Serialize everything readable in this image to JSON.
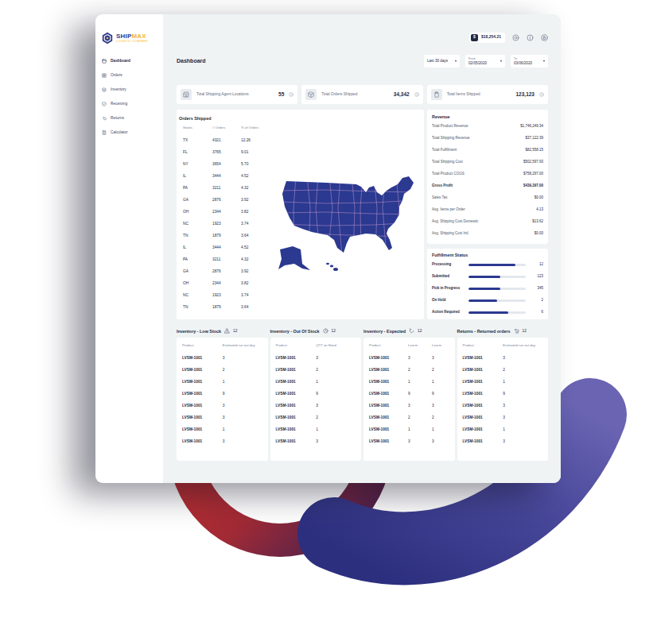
{
  "logo": {
    "name_a": "SHIP",
    "name_b": "MAX",
    "tagline": "LOGISTIC COMPANY"
  },
  "sidebar": {
    "items": [
      {
        "label": "Dashboard",
        "selected": true
      },
      {
        "label": "Orders",
        "selected": false
      },
      {
        "label": "Inventory",
        "selected": false
      },
      {
        "label": "Receiving",
        "selected": false
      },
      {
        "label": "Returns",
        "selected": false
      },
      {
        "label": "Calculator",
        "selected": false
      }
    ]
  },
  "header": {
    "currency_symbol": "$",
    "balance": "$18,254.21"
  },
  "page": {
    "title": "Dashboard",
    "range": "Last 30 days",
    "from_label": "From",
    "from": "02/05/2020",
    "to_label": "To",
    "to": "03/06/2020"
  },
  "stats": [
    {
      "label": "Total Shipping Agent Locations",
      "value": "55"
    },
    {
      "label": "Total Orders Shipped",
      "value": "34,342"
    },
    {
      "label": "Total Items Shipped",
      "value": "123,123"
    }
  ],
  "orders": {
    "title": "Orders Shipped",
    "columns": [
      "States",
      "# Orders",
      "% of Orders"
    ],
    "rows": [
      [
        "TX",
        "4321",
        "12.26"
      ],
      [
        "FL",
        "3765",
        "9.01"
      ],
      [
        "NY",
        "3654",
        "5.70"
      ],
      [
        "IL",
        "3444",
        "4.52"
      ],
      [
        "PA",
        "3211",
        "4.32"
      ],
      [
        "GA",
        "2876",
        "3.92"
      ],
      [
        "OH",
        "2344",
        "3.82"
      ],
      [
        "NC",
        "1923",
        "3.74"
      ],
      [
        "TN",
        "1879",
        "3.64"
      ],
      [
        "IL",
        "3444",
        "4.52"
      ],
      [
        "PA",
        "3211",
        "4.32"
      ],
      [
        "GA",
        "2876",
        "3.92"
      ],
      [
        "OH",
        "2344",
        "3.82"
      ],
      [
        "NC",
        "1923",
        "3.74"
      ],
      [
        "TN",
        "1879",
        "3.64"
      ]
    ]
  },
  "revenue": {
    "title": "Revenue",
    "rows": [
      {
        "label": "Total Product Revenue",
        "value": "$1,746,249.34",
        "emphasized": false
      },
      {
        "label": "Total Shipping Revenue",
        "value": "$37,122.39",
        "emphasized": false
      },
      {
        "label": "Total Fulfillment",
        "value": "$82,558.15",
        "emphasized": false
      },
      {
        "label": "Total Shipping Cost",
        "value": "$502,597.93",
        "emphasized": false
      },
      {
        "label": "Total Product COGS",
        "value": "$758,297.00",
        "emphasized": false
      },
      {
        "label": "Gross Profit",
        "value": "$439,297.00",
        "emphasized": true
      },
      {
        "label": "Sales Tax",
        "value": "$0.00",
        "emphasized": false
      },
      {
        "label": "Avg. Items per Order",
        "value": "4.13",
        "emphasized": false
      },
      {
        "label": "Avg. Shipping Cost Domestic",
        "value": "$13.62",
        "emphasized": false
      },
      {
        "label": "Avg. Shipping Cost Intl.",
        "value": "$0.00",
        "emphasized": false
      }
    ]
  },
  "fulfillment": {
    "title": "Fulfillment Status",
    "items": [
      {
        "label": "Processing",
        "count": "12",
        "level": 0.82
      },
      {
        "label": "Submitted",
        "count": "123",
        "level": 0.55
      },
      {
        "label": "Pick in Progress",
        "count": "345",
        "level": 0.55
      },
      {
        "label": "On Hold",
        "count": "2",
        "level": 0.5
      },
      {
        "label": "Action Required",
        "count": "6",
        "level": 0.7
      }
    ]
  },
  "panels": [
    {
      "title": "Inventory - Low Stock",
      "count": "12",
      "columns": [
        "Product",
        "Estimated run out day"
      ],
      "rows": [
        [
          "LVSM-1001",
          "3"
        ],
        [
          "LVSM-1001",
          "2"
        ],
        [
          "LVSM-1001",
          "1"
        ],
        [
          "LVSM-1001",
          "9"
        ],
        [
          "LVSM-1001",
          "3"
        ],
        [
          "LVSM-1001",
          "3"
        ],
        [
          "LVSM-1001",
          "1"
        ],
        [
          "LVSM-1001",
          "3"
        ]
      ]
    },
    {
      "title": "Inventory - Out Of Stock",
      "count": "12",
      "columns": [
        "Product",
        "QTY on Hand"
      ],
      "rows": [
        [
          "LVSM-1001",
          "3"
        ],
        [
          "LVSM-1001",
          "2"
        ],
        [
          "LVSM-1001",
          "1"
        ],
        [
          "LVSM-1001",
          "9"
        ],
        [
          "LVSM-1001",
          "3"
        ],
        [
          "LVSM-1001",
          "2"
        ],
        [
          "LVSM-1001",
          "1"
        ],
        [
          "LVSM-1001",
          "3"
        ]
      ]
    },
    {
      "title": "Inventory - Expected",
      "count": "12",
      "columns": [
        "Product",
        "Lorem",
        "Lorem"
      ],
      "rows": [
        [
          "LVSM-1001",
          "3",
          "3"
        ],
        [
          "LVSM-1001",
          "2",
          "2"
        ],
        [
          "LVSM-1001",
          "1",
          "1"
        ],
        [
          "LVSM-1001",
          "9",
          "9"
        ],
        [
          "LVSM-1001",
          "3",
          "3"
        ],
        [
          "LVSM-1001",
          "2",
          "2"
        ],
        [
          "LVSM-1001",
          "1",
          "1"
        ],
        [
          "LVSM-1001",
          "3",
          "3"
        ]
      ]
    },
    {
      "title": "Returns - Returned orders",
      "count": "12",
      "columns": [
        "Product",
        "Estimated run out day"
      ],
      "rows": [
        [
          "LVSM-1001",
          "3"
        ],
        [
          "LVSM-1001",
          "2"
        ],
        [
          "LVSM-1001",
          "1"
        ],
        [
          "LVSM-1001",
          "9"
        ],
        [
          "LVSM-1001",
          "3"
        ],
        [
          "LVSM-1001",
          "3"
        ],
        [
          "LVSM-1001",
          "1"
        ],
        [
          "LVSM-1001",
          "3"
        ]
      ]
    }
  ]
}
